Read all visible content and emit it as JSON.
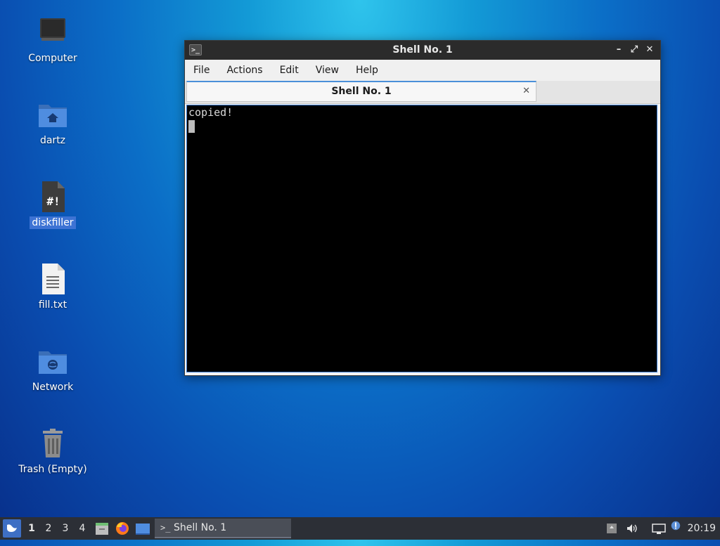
{
  "desktop": {
    "icons": [
      {
        "name": "Computer"
      },
      {
        "name": "dartz"
      },
      {
        "name": "diskfiller"
      },
      {
        "name": "fill.txt"
      },
      {
        "name": "Network"
      },
      {
        "name": "Trash (Empty)"
      }
    ]
  },
  "window": {
    "title": "Shell No. 1",
    "menu": [
      "File",
      "Actions",
      "Edit",
      "View",
      "Help"
    ],
    "tab_label": "Shell No. 1",
    "terminal_output": "copied!"
  },
  "taskbar": {
    "workspaces": [
      "1",
      "2",
      "3",
      "4"
    ],
    "task_label": "Shell No. 1",
    "clock": "20:19"
  },
  "colors": {
    "selection": "#3d73d4",
    "taskbar": "#2c2f36",
    "window_title": "#2b2b2b"
  }
}
